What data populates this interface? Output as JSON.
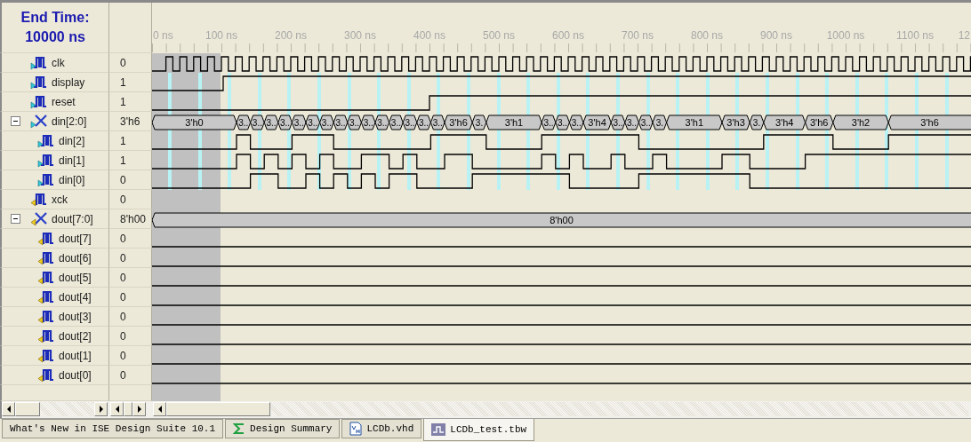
{
  "header": {
    "title": "End Time:",
    "end_time": "10000 ns"
  },
  "time_axis": {
    "labels": [
      "0 ns",
      "100 ns",
      "200 ns",
      "300 ns",
      "400 ns",
      "500 ns",
      "600 ns",
      "700 ns",
      "800 ns",
      "900 ns",
      "1000 ns",
      "1100 ns",
      "12"
    ]
  },
  "signals": [
    {
      "name": "clk",
      "value": "0",
      "output": false,
      "kind": "clock"
    },
    {
      "name": "display",
      "value": "1",
      "output": false,
      "kind": "bit"
    },
    {
      "name": "reset",
      "value": "1",
      "output": false,
      "kind": "bit"
    },
    {
      "name": "din[2:0]",
      "value": "3'h6",
      "output": false,
      "kind": "bus",
      "expanded": true,
      "segments": [
        "3'h0",
        "3..",
        "3..",
        "3..",
        "3..",
        "3..",
        "3..",
        "3..",
        "3..",
        "3..",
        "3..",
        "3..",
        "3..",
        "3..",
        "3..",
        "3..",
        "3'h6",
        "3.",
        "3'h1",
        "3..",
        "3..",
        "3..",
        "3'h4",
        "3..",
        "3..",
        "3..",
        "3.",
        "3'h1",
        "3'h3",
        "3.",
        "3'h4",
        "3'h6",
        "3'h2",
        "3'h6"
      ],
      "children": [
        {
          "name": "din[2]",
          "value": "1",
          "output": false,
          "kind": "bit"
        },
        {
          "name": "din[1]",
          "value": "1",
          "output": false,
          "kind": "bit"
        },
        {
          "name": "din[0]",
          "value": "0",
          "output": false,
          "kind": "bit"
        }
      ]
    },
    {
      "name": "xck",
      "value": "0",
      "output": true,
      "kind": "bit"
    },
    {
      "name": "dout[7:0]",
      "value": "8'h00",
      "output": true,
      "kind": "bus",
      "expanded": true,
      "segments": [
        "8'h00"
      ],
      "children": [
        {
          "name": "dout[7]",
          "value": "0",
          "output": true,
          "kind": "bit"
        },
        {
          "name": "dout[6]",
          "value": "0",
          "output": true,
          "kind": "bit"
        },
        {
          "name": "dout[5]",
          "value": "0",
          "output": true,
          "kind": "bit"
        },
        {
          "name": "dout[4]",
          "value": "0",
          "output": true,
          "kind": "bit"
        },
        {
          "name": "dout[3]",
          "value": "0",
          "output": true,
          "kind": "bit"
        },
        {
          "name": "dout[2]",
          "value": "0",
          "output": true,
          "kind": "bit"
        },
        {
          "name": "dout[1]",
          "value": "0",
          "output": true,
          "kind": "bit"
        },
        {
          "name": "dout[0]",
          "value": "0",
          "output": true,
          "kind": "bit"
        }
      ]
    }
  ],
  "tabs": [
    {
      "label": "What's New in ISE Design Suite 10.1",
      "kind": "page",
      "selected": false
    },
    {
      "label": "Design Summary",
      "kind": "summary",
      "selected": false
    },
    {
      "label": "LCDb.vhd",
      "kind": "source",
      "selected": false
    },
    {
      "label": "LCDb_test.tbw",
      "kind": "waveform",
      "selected": true
    }
  ]
}
